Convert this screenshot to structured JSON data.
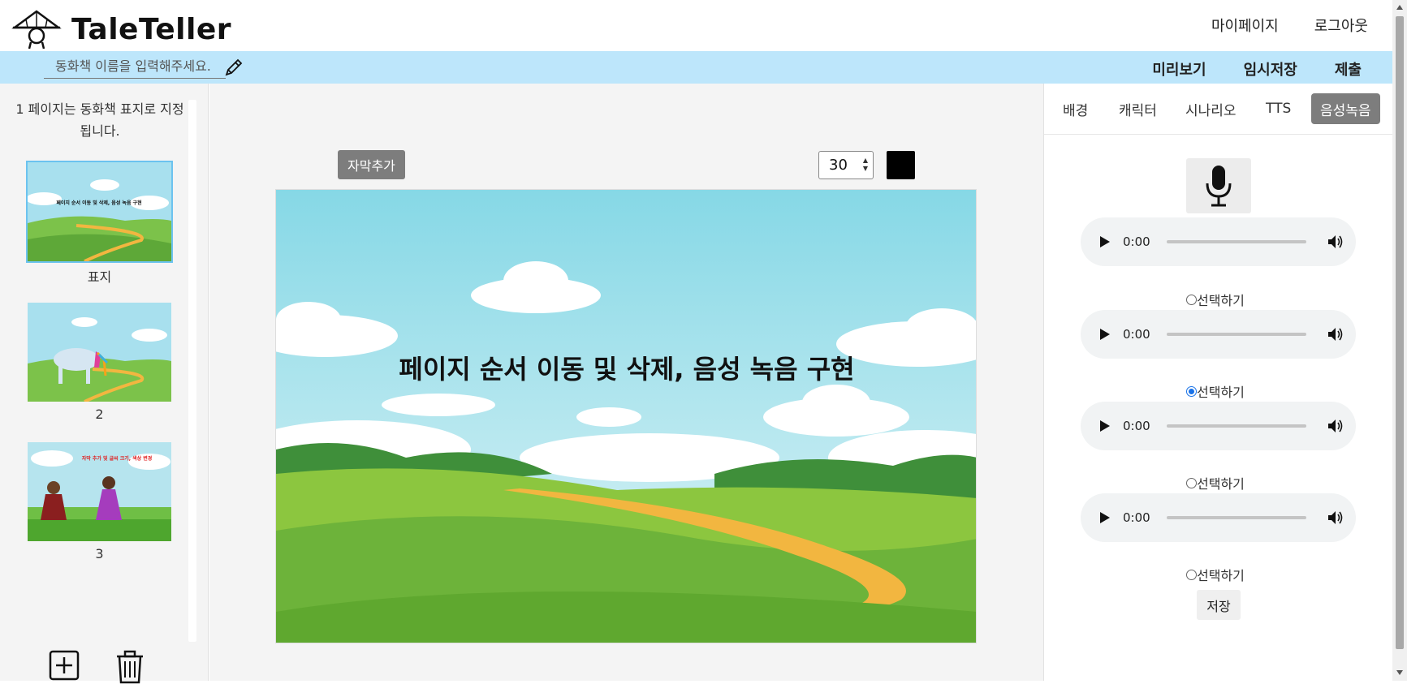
{
  "app": {
    "name": "TaleTeller"
  },
  "header": {
    "nav": [
      "마이페이지",
      "로그아웃"
    ]
  },
  "toolbar": {
    "title_placeholder": "동화책 이름을 입력해주세요.",
    "actions": [
      "미리보기",
      "임시저장",
      "제출"
    ]
  },
  "left": {
    "note": "1 페이지는 동화책 표지로 지정됩니다.",
    "pages": [
      {
        "label": "표지",
        "caption": "페이지 순서 이동 및 삭제, 음성 녹음 구현",
        "selected": true
      },
      {
        "label": "2",
        "caption": "",
        "selected": false
      },
      {
        "label": "3",
        "caption": "자막 추가 및 글씨 크기, 색상 변경",
        "selected": false
      }
    ],
    "tools": [
      "add-page-icon",
      "trash-icon"
    ]
  },
  "editor": {
    "add_caption_label": "자막추가",
    "font_size": "30",
    "text_color": "#000000",
    "canvas_caption": "페이지 순서 이동 및 삭제, 음성 녹음 구현"
  },
  "right": {
    "tabs": [
      {
        "label": "배경",
        "active": false
      },
      {
        "label": "캐릭터",
        "active": false
      },
      {
        "label": "시나리오",
        "active": false
      },
      {
        "label": "TTS",
        "active": false
      },
      {
        "label": "음성녹음",
        "active": true
      }
    ],
    "recordings": [
      {
        "time": "0:00",
        "select_label": "선택하기",
        "selected": false
      },
      {
        "time": "0:00",
        "select_label": "선택하기",
        "selected": true
      },
      {
        "time": "0:00",
        "select_label": "선택하기",
        "selected": false
      },
      {
        "time": "0:00",
        "select_label": "선택하기",
        "selected": false
      }
    ],
    "save_label": "저장"
  },
  "colors": {
    "toolbar_bg": "#bde6fb",
    "button_gray": "#7d7d7d",
    "radio_blue": "#1a73e8"
  }
}
